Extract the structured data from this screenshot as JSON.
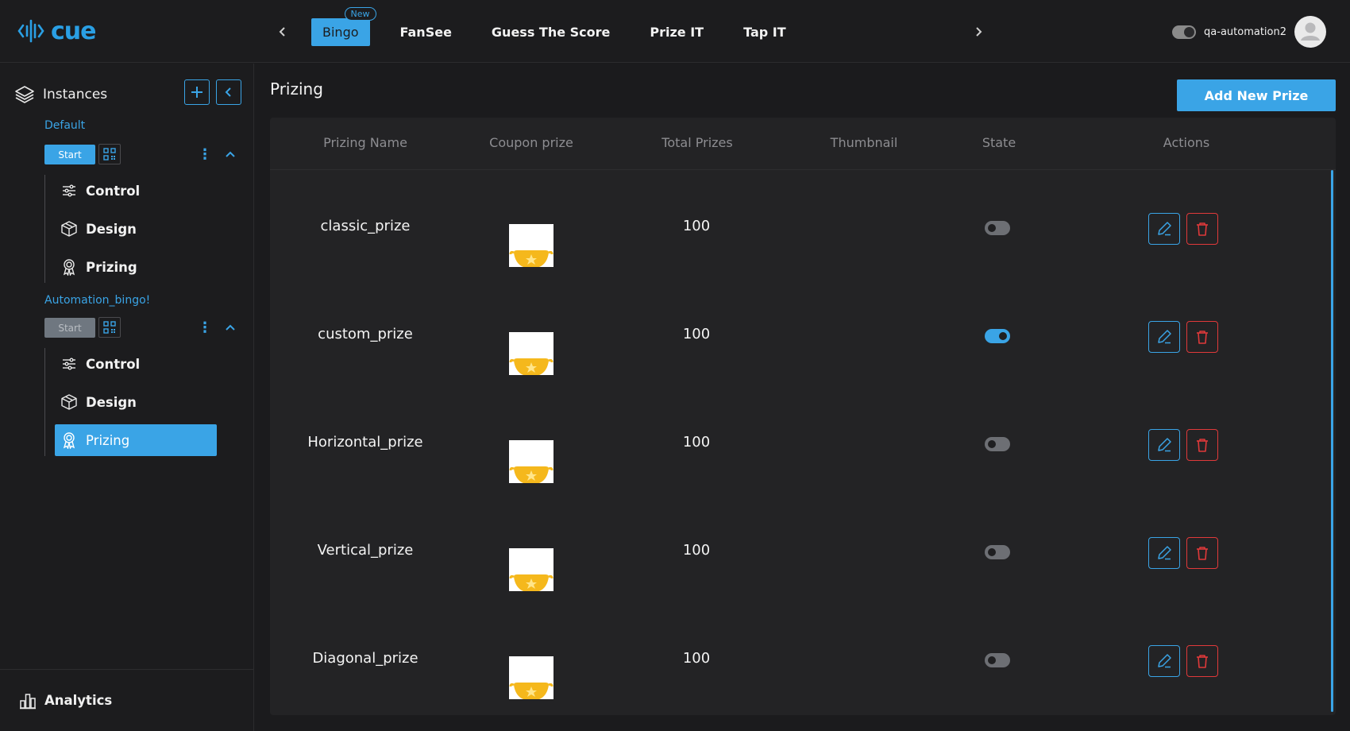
{
  "brand": {
    "logo_text": "cue",
    "accent": "#3aa4e6",
    "danger": "#e0393a"
  },
  "header": {
    "tabs": [
      {
        "label": "Bingo",
        "badge": "New",
        "active": true
      },
      {
        "label": "FanSee"
      },
      {
        "label": "Guess The Score"
      },
      {
        "label": "Prize IT"
      },
      {
        "label": "Tap IT"
      }
    ],
    "username": "qa-automation2"
  },
  "sidebar": {
    "title": "Instances",
    "instances": [
      {
        "name": "Default",
        "start_label": "Start",
        "start_enabled": true,
        "items": [
          {
            "label": "Control",
            "icon": "sliders-icon"
          },
          {
            "label": "Design",
            "icon": "cube-icon"
          },
          {
            "label": "Prizing",
            "icon": "award-icon"
          }
        ]
      },
      {
        "name": "Automation_bingo!",
        "start_label": "Start",
        "start_enabled": false,
        "items": [
          {
            "label": "Control",
            "icon": "sliders-icon"
          },
          {
            "label": "Design",
            "icon": "cube-icon"
          },
          {
            "label": "Prizing",
            "icon": "award-icon",
            "active": true
          }
        ]
      }
    ],
    "bottom": {
      "label": "Analytics",
      "icon": "bar-chart-icon"
    }
  },
  "main": {
    "title": "Prizing",
    "add_button": "Add New Prize",
    "columns": [
      "Prizing Name",
      "Coupon prize",
      "Total Prizes",
      "Thumbnail",
      "State",
      "Actions"
    ],
    "rows": [
      {
        "name": "classic_prize",
        "total": "100",
        "state": false
      },
      {
        "name": "custom_prize",
        "total": "100",
        "state": true
      },
      {
        "name": "Horizontal_prize",
        "total": "100",
        "state": false
      },
      {
        "name": "Vertical_prize",
        "total": "100",
        "state": false
      },
      {
        "name": "Diagonal_prize",
        "total": "100",
        "state": false
      }
    ]
  }
}
